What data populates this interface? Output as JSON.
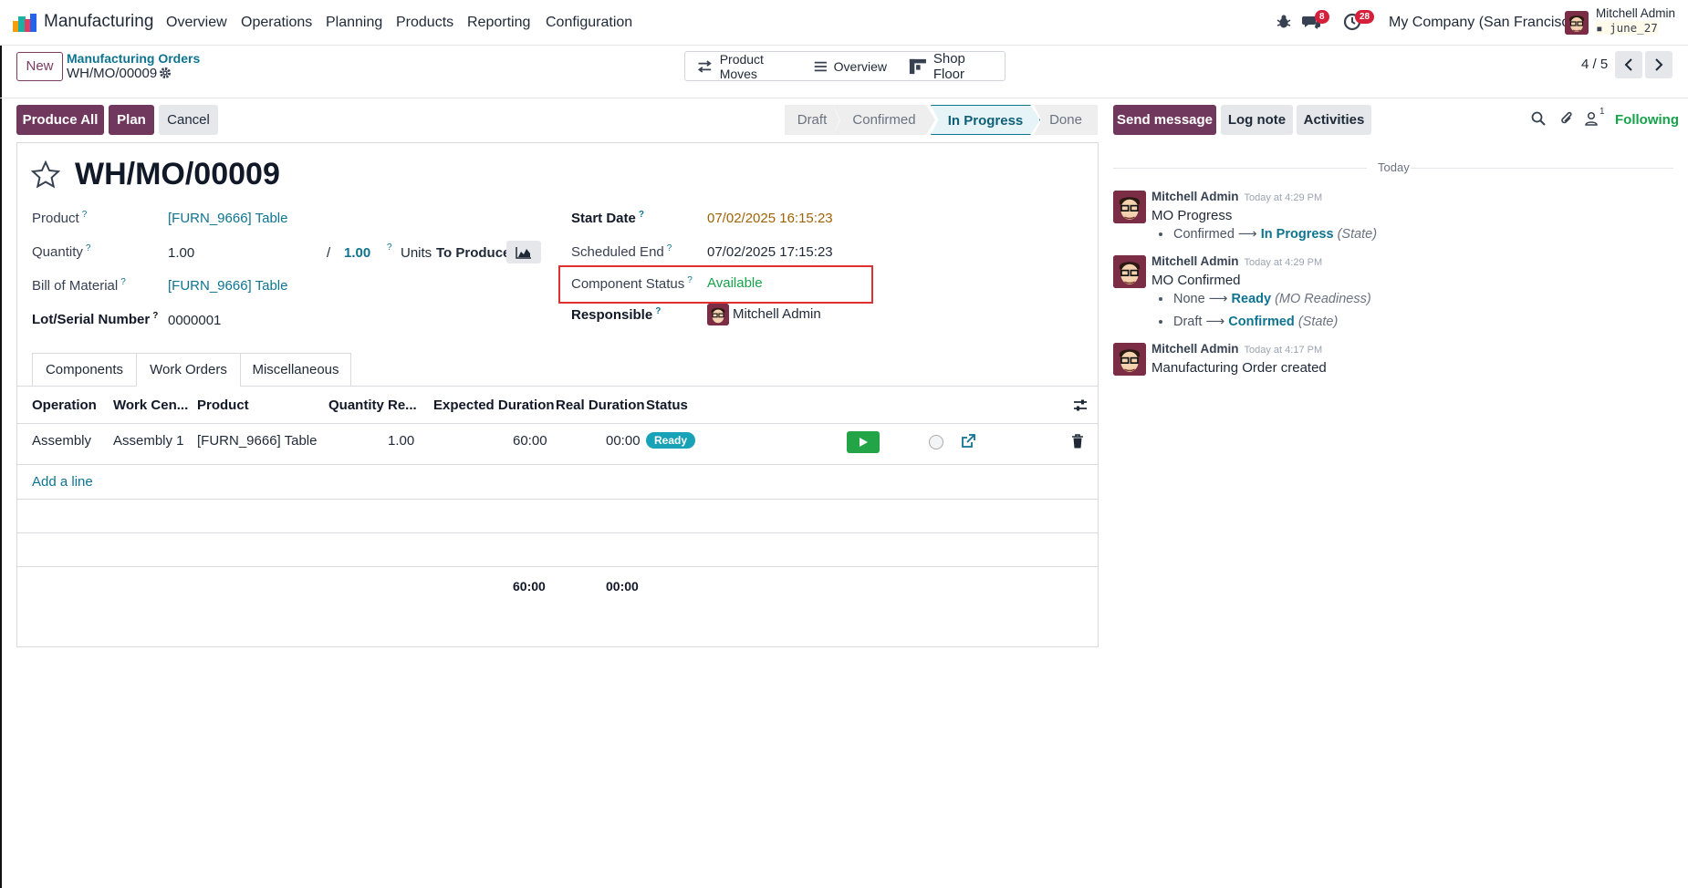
{
  "navbar": {
    "app_name": "Manufacturing",
    "menus": [
      "Overview",
      "Operations",
      "Planning",
      "Products",
      "Reporting",
      "Configuration"
    ],
    "messages_badge": "8",
    "activities_badge": "28",
    "company": "My Company (San Francisco)",
    "user_name": "Mitchell Admin",
    "db_name": "june_27"
  },
  "control": {
    "new_label": "New",
    "breadcrumb_parent": "Manufacturing Orders",
    "breadcrumb_current": "WH/MO/00009",
    "smart_buttons": [
      "Product Moves",
      "Overview",
      "Shop Floor"
    ],
    "pager": "4 / 5"
  },
  "actions": {
    "produce_all": "Produce All",
    "plan": "Plan",
    "cancel": "Cancel"
  },
  "stages": [
    "Draft",
    "Confirmed",
    "In Progress",
    "Done"
  ],
  "active_stage": "In Progress",
  "form": {
    "title": "WH/MO/00009",
    "product_label": "Product",
    "product_value": "[FURN_9666] Table",
    "quantity_label": "Quantity",
    "quantity_value": "1.00",
    "quantity_slash": "/",
    "quantity_target": "1.00",
    "units_label": "Units",
    "to_produce_label": "To Produce",
    "bom_label": "Bill of Material",
    "bom_value": "[FURN_9666] Table",
    "lot_label": "Lot/Serial Number",
    "lot_value": "0000001",
    "start_label": "Start Date",
    "start_value": "07/02/2025 16:15:23",
    "end_label": "Scheduled End",
    "end_value": "07/02/2025 17:15:23",
    "component_label": "Component Status",
    "component_value": "Available",
    "responsible_label": "Responsible",
    "responsible_value": "Mitchell Admin",
    "help_mark": "?"
  },
  "tabs": [
    "Components",
    "Work Orders",
    "Miscellaneous"
  ],
  "active_tab": "Work Orders",
  "table": {
    "headers": [
      "Operation",
      "Work Cen...",
      "Product",
      "Quantity Re...",
      "Expected Duration",
      "Real Duration",
      "Status"
    ],
    "rows": [
      {
        "operation": "Assembly",
        "work_center": "Assembly 1",
        "product": "[FURN_9666] Table",
        "quantity": "1.00",
        "expected": "60:00",
        "real": "00:00",
        "status": "Ready"
      }
    ],
    "add_line": "Add a line",
    "total_expected": "60:00",
    "total_real": "00:00"
  },
  "chatter": {
    "send_message": "Send message",
    "log_note": "Log note",
    "activities": "Activities",
    "followers_count": "1",
    "following": "Following",
    "today": "Today",
    "messages": [
      {
        "author": "Mitchell Admin",
        "time": "Today at 4:29 PM",
        "body": "MO Progress",
        "tracking": [
          {
            "old": "Confirmed",
            "new": "In Progress",
            "field": "(State)"
          }
        ]
      },
      {
        "author": "Mitchell Admin",
        "time": "Today at 4:29 PM",
        "body": "MO Confirmed",
        "tracking": [
          {
            "old": "None",
            "new": "Ready",
            "field": "(MO Readiness)"
          },
          {
            "old": "Draft",
            "new": "Confirmed",
            "field": "(State)"
          }
        ]
      },
      {
        "author": "Mitchell Admin",
        "time": "Today at 4:17 PM",
        "body": "Manufacturing Order created",
        "tracking": []
      }
    ]
  },
  "colors": {
    "primary": "#71385d",
    "link": "#0e7490",
    "available": "#16a34a",
    "highlight_box": "#e03131",
    "ready_badge": "#17a2b8",
    "play_button": "#22a447"
  }
}
